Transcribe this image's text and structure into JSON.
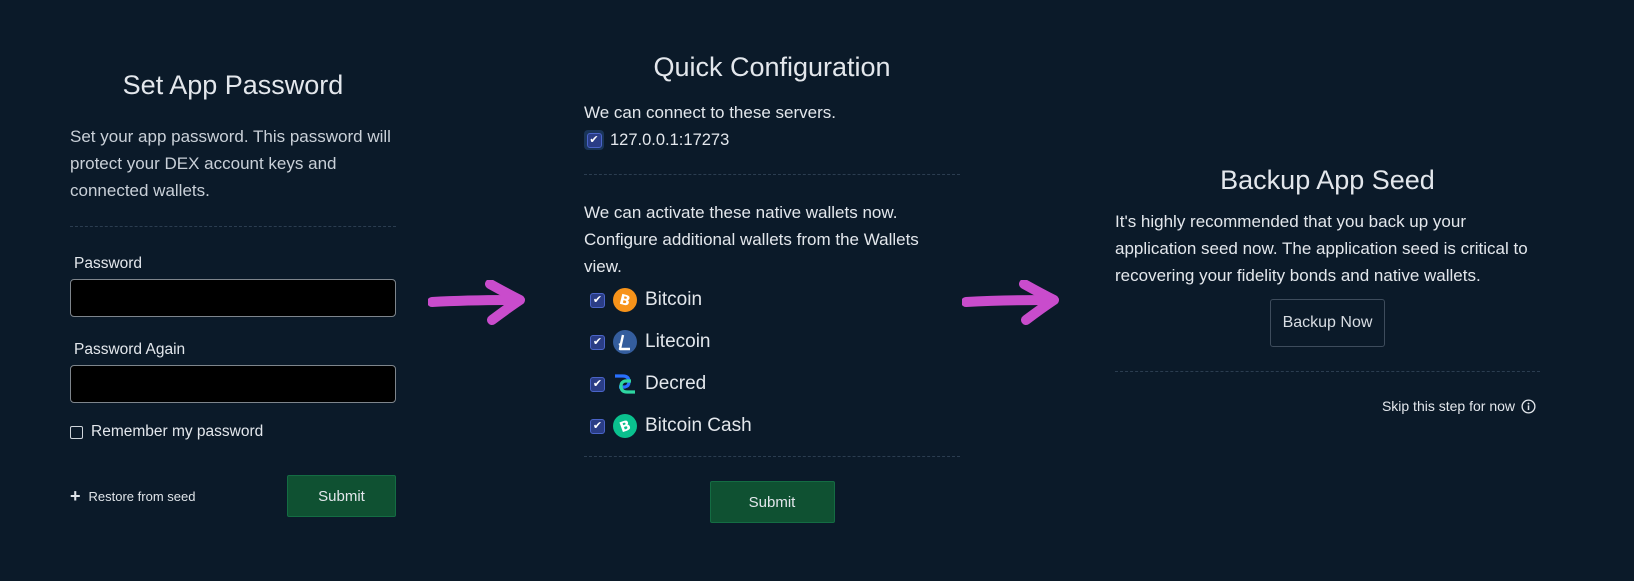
{
  "set_password": {
    "title": "Set App Password",
    "description": "Set your app password. This password will protect your DEX account keys and connected wallets.",
    "password_label": "Password",
    "password_again_label": "Password Again",
    "remember_label": "Remember my password",
    "restore_label": "Restore from seed",
    "submit_label": "Submit"
  },
  "quick_config": {
    "title": "Quick Configuration",
    "servers_text": "We can connect to these servers.",
    "server": "127.0.0.1:17273",
    "wallets_text": "We can activate these native wallets now. Configure additional wallets from the Wallets view.",
    "wallets": [
      {
        "name": "Bitcoin",
        "icon": "bitcoin-icon",
        "color": "#f7931a"
      },
      {
        "name": "Litecoin",
        "icon": "litecoin-icon",
        "color": "#345d9d"
      },
      {
        "name": "Decred",
        "icon": "decred-icon",
        "color": "#2ed6a1"
      },
      {
        "name": "Bitcoin Cash",
        "icon": "bitcoin-cash-icon",
        "color": "#0ac18e"
      }
    ],
    "submit_label": "Submit"
  },
  "backup": {
    "title": "Backup App Seed",
    "description": "It's highly recommended that you back up your application seed now. The application seed is critical to recovering your fidelity bonds and native wallets.",
    "backup_label": "Backup Now",
    "skip_label": "Skip this step for now"
  },
  "colors": {
    "background": "#0b1a29",
    "submit": "#0f5132",
    "arrow": "#c94ccc",
    "checkbox": "#2a3d86"
  }
}
